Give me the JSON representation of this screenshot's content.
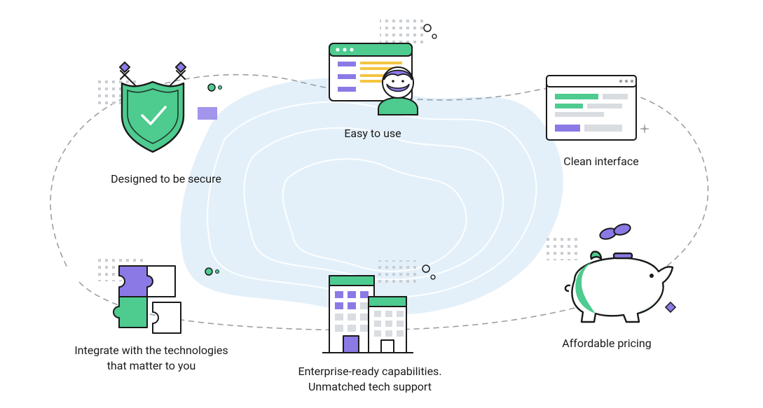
{
  "features": {
    "secure": {
      "label": "Designed to be secure"
    },
    "easy": {
      "label": "Easy to use"
    },
    "clean": {
      "label": "Clean interface"
    },
    "integrate": {
      "label": "Integrate with the technologies\nthat matter to you"
    },
    "enterprise": {
      "label": "Enterprise-ready capabilities.\nUnmatched tech support"
    },
    "pricing": {
      "label": "Affordable pricing"
    }
  },
  "palette": {
    "green": "#4ECB8F",
    "greenDark": "#27AE60",
    "purple": "#8B7AE6",
    "yellow": "#F4C542",
    "blueBg": "#E3F0FA",
    "gray": "#9AA0A6",
    "line": "#1a1a1a"
  }
}
